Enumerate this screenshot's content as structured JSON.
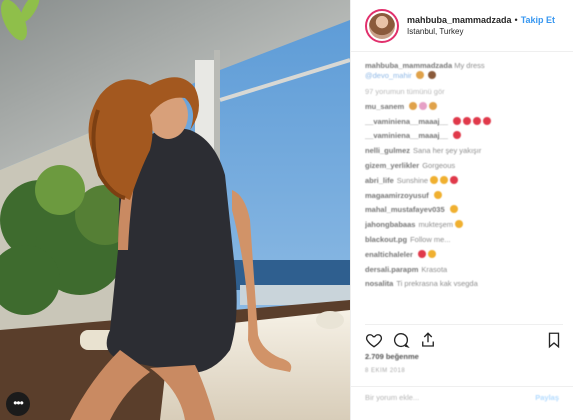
{
  "header": {
    "username": "mahbuba_mammadzada",
    "separator": "•",
    "follow_label": "Takip Et",
    "location": "Istanbul, Turkey"
  },
  "caption": {
    "username": "mahbuba_mammadzada",
    "text": "My dress",
    "mention": "@devo_mahir"
  },
  "view_replies": "97 yorumun tümünü gör",
  "comments": [
    {
      "user": "mu_sanem",
      "text": "",
      "emoji": [
        "#e0a24a",
        "#e6a0c6",
        "#e0a24a"
      ]
    },
    {
      "user": "__vaminiena__maaaj__",
      "text": "",
      "emoji": [
        "#e0394a",
        "#e0394a",
        "#e0394a",
        "#e0394a"
      ]
    },
    {
      "user": "__vaminiena__maaaj__",
      "text": "",
      "emoji": [
        "#e0394a"
      ]
    },
    {
      "user": "nelli_gulmez",
      "text": "Sana her şey yakışır",
      "emoji": []
    },
    {
      "user": "gizem_yerlikler",
      "text": "Gorgeous",
      "emoji": []
    },
    {
      "user": "abri_life",
      "text": "Sunshine",
      "emoji": [
        "#f0b030",
        "#f0b030",
        "#e0394a"
      ]
    },
    {
      "user": "magaamirzoyusuf",
      "text": "",
      "emoji": [
        "#f0b030"
      ]
    },
    {
      "user": "mahal_mustafayev035",
      "text": "",
      "emoji": [
        "#f0b030"
      ]
    },
    {
      "user": "jahongbabaas",
      "text": "mukteşem",
      "emoji": [
        "#f0b030"
      ]
    },
    {
      "user": "blackout.pg",
      "text": "Follow me...",
      "emoji": []
    },
    {
      "user": "enaltichaleler",
      "text": "",
      "emoji": [
        "#e0394a",
        "#f0b030"
      ]
    },
    {
      "user": "dersali.parapm",
      "text": "Krasota",
      "emoji": []
    },
    {
      "user": "nosalita",
      "text": "Ti prekrasna kak vsegda",
      "emoji": []
    }
  ],
  "likes": "2.709 beğenme",
  "date": "8 EKİM 2018",
  "add_comment": {
    "placeholder": "Bir yorum ekle...",
    "post_label": "Paylaş"
  },
  "more_label": "•••",
  "icons": {
    "like": "heart-icon",
    "comment": "comment-icon",
    "share": "share-icon",
    "save": "bookmark-icon"
  },
  "colors": {
    "follow": "#3897f0",
    "sky": "#6fa9dd",
    "sea": "#2f5f8f"
  }
}
